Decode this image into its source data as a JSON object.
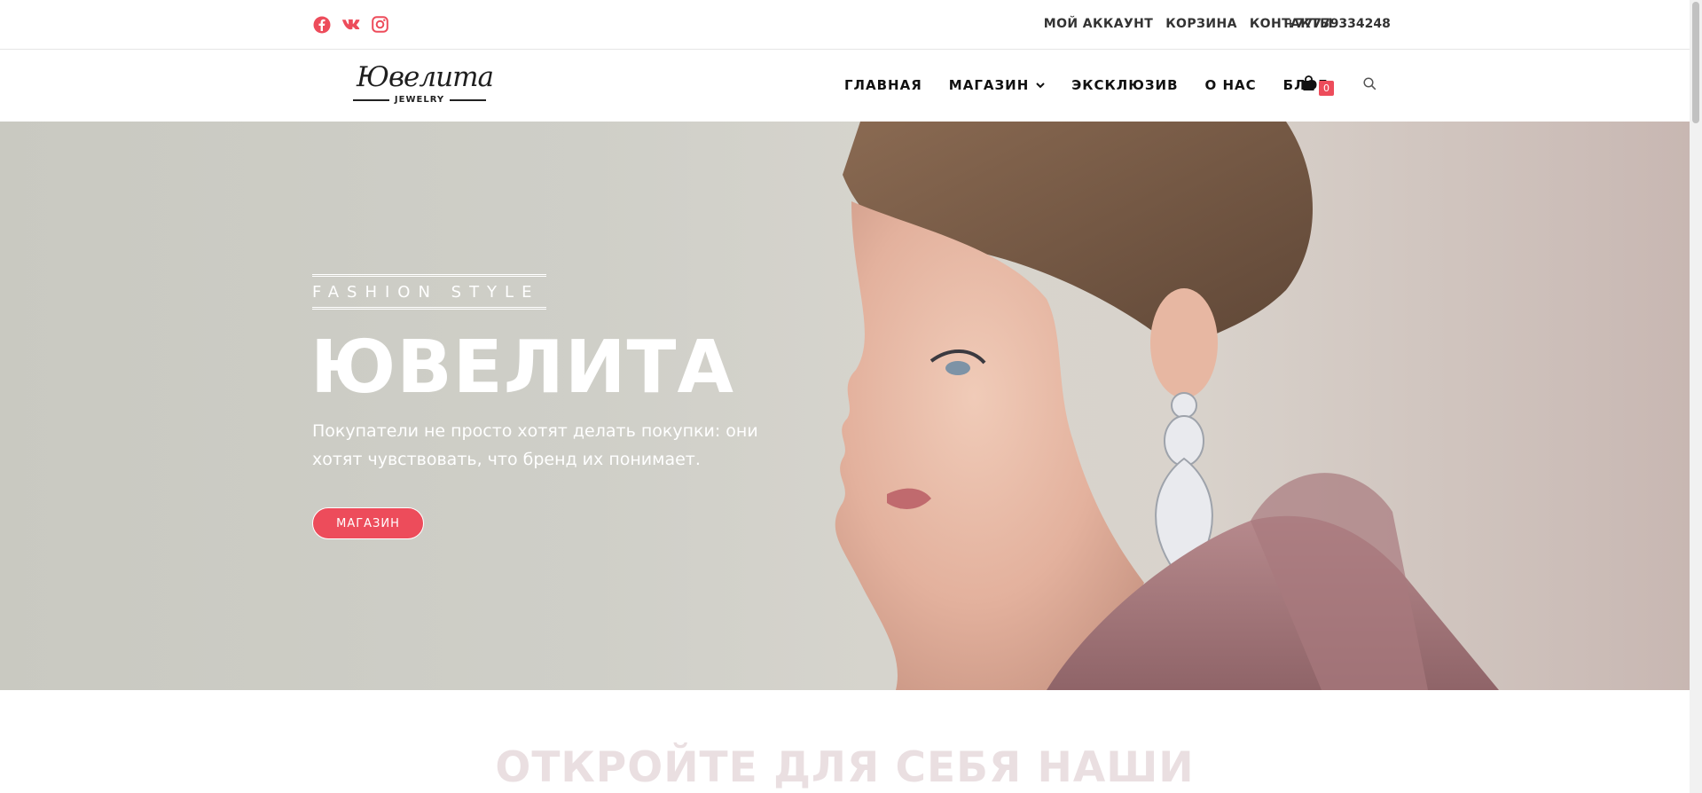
{
  "topbar": {
    "social": [
      {
        "name": "facebook-icon"
      },
      {
        "name": "vk-icon"
      },
      {
        "name": "instagram-icon"
      }
    ],
    "links": [
      "МОЙ АККАУНТ",
      "КОРЗИНА",
      "КОНТАКТЫ"
    ],
    "phone": "+77779334248"
  },
  "logo": {
    "script": "Ювелита",
    "sub": "JEWELRY"
  },
  "nav": {
    "items": [
      "ГЛАВНАЯ",
      "МАГАЗИН",
      "ЭКСКЛЮЗИВ",
      "О НАС",
      "БЛОГ"
    ],
    "cart_count": "0"
  },
  "hero": {
    "kicker": "FASHION STYLE",
    "title": "ЮВЕЛИТА",
    "text": "Покупатели не просто хотят делать покупки: они хотят чувствовать, что бренд их понимает.",
    "button": "МАГАЗИН"
  },
  "section": {
    "heading": "ОТКРОЙТЕ ДЛЯ СЕБЯ НАШИ"
  },
  "colors": {
    "accent": "#ed4c5b"
  }
}
